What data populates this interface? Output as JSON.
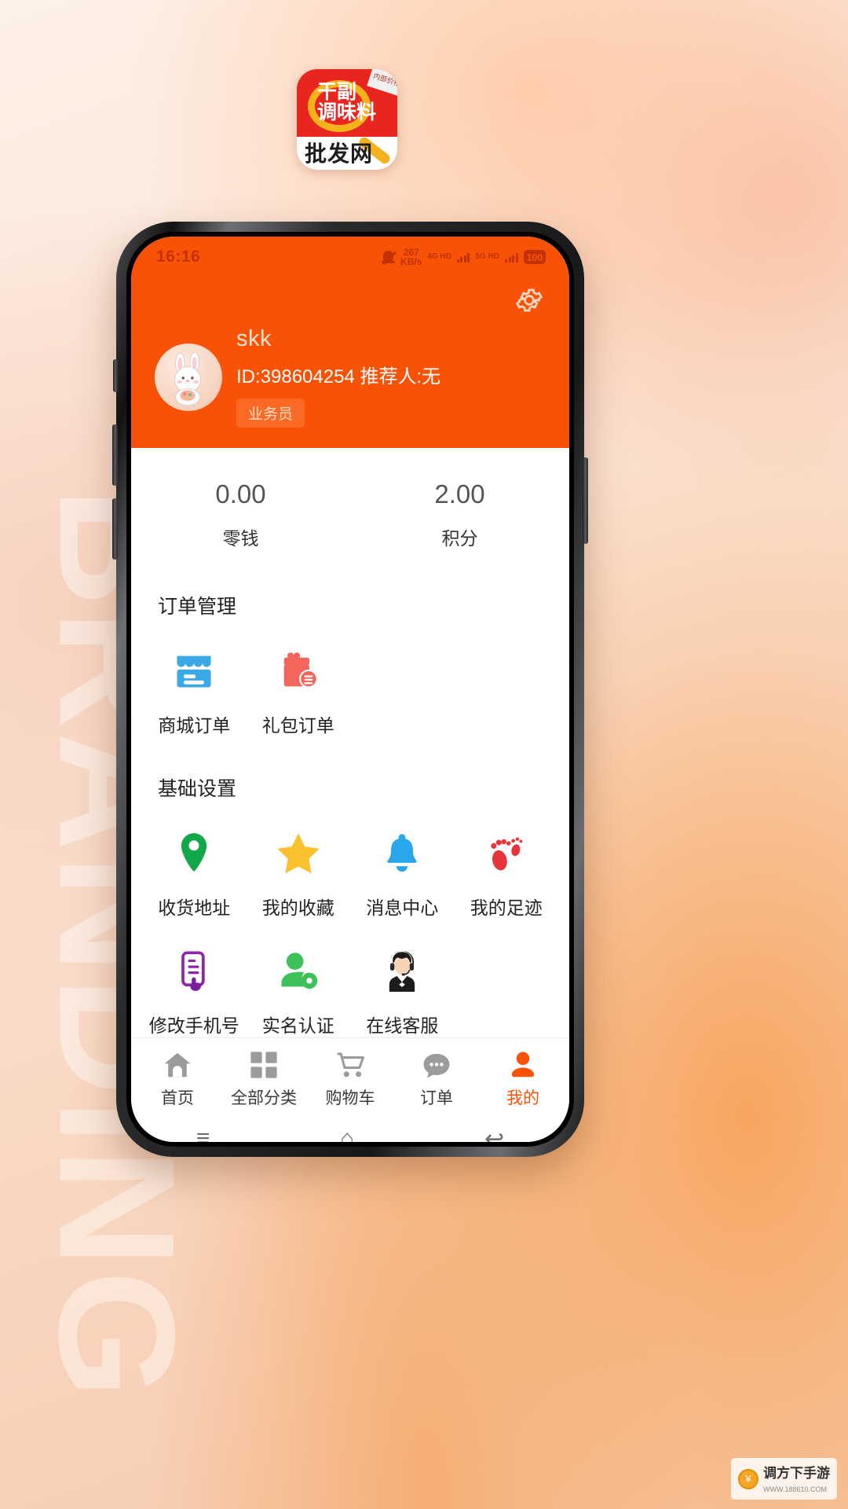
{
  "app_icon": {
    "line1": "干副",
    "line2": "调味料",
    "line3": "批发网",
    "corner_tag": "内部价格"
  },
  "background": {
    "decorative_word": "BRANDING",
    "page_bg": "#f7d8c2"
  },
  "colors": {
    "brand_orange": "#f85207",
    "status_text": "#c23204",
    "store_blue": "#3ba9e8",
    "gift_red": "#f4655c",
    "pin_green": "#12a749",
    "star_yellow": "#fbc02d",
    "bell_blue": "#29a7ea",
    "foot_red": "#e8353b",
    "doc_purple": "#8e24aa",
    "person_green": "#3ec05a"
  },
  "statusbar": {
    "time": "16:16",
    "mute_icon": "bell-muted-icon",
    "net_speed_value": "267",
    "net_speed_unit": "KB/s",
    "network1": "4G HD",
    "network2": "5G HD",
    "battery": "100"
  },
  "header": {
    "settings_icon": "gear-icon",
    "avatar_icon": "bunny-avatar",
    "username": "skk",
    "id_line": "ID:398604254 推荐人:无",
    "role_badge": "业务员"
  },
  "wallet": [
    {
      "value": "0.00",
      "label": "零钱"
    },
    {
      "value": "2.00",
      "label": "积分"
    }
  ],
  "sections": [
    {
      "title": "订单管理",
      "items": [
        {
          "label": "商城订单",
          "icon": "store-icon"
        },
        {
          "label": "礼包订单",
          "icon": "gift-icon"
        }
      ]
    },
    {
      "title": "基础设置",
      "items": [
        {
          "label": "收货地址",
          "icon": "location-pin-icon"
        },
        {
          "label": "我的收藏",
          "icon": "star-icon"
        },
        {
          "label": "消息中心",
          "icon": "bell-icon"
        },
        {
          "label": "我的足迹",
          "icon": "footprints-icon"
        },
        {
          "label": "修改手机号",
          "icon": "document-tap-icon"
        },
        {
          "label": "实名认证",
          "icon": "person-gear-icon"
        },
        {
          "label": "在线客服",
          "icon": "headset-agent-icon"
        }
      ]
    }
  ],
  "tabbar": [
    {
      "label": "首页",
      "icon": "home-icon",
      "active": false
    },
    {
      "label": "全部分类",
      "icon": "grid-icon",
      "active": false
    },
    {
      "label": "购物车",
      "icon": "cart-icon",
      "active": false
    },
    {
      "label": "订单",
      "icon": "chat-icon",
      "active": false
    },
    {
      "label": "我的",
      "icon": "user-icon",
      "active": true
    }
  ],
  "android_nav": [
    {
      "icon": "menu-icon",
      "glyph": "≡"
    },
    {
      "icon": "home-icon",
      "glyph": "⌂"
    },
    {
      "icon": "back-icon",
      "glyph": "↩"
    }
  ],
  "watermark": {
    "title": "调方下手游",
    "subtitle": "WWW.188610.COM"
  }
}
